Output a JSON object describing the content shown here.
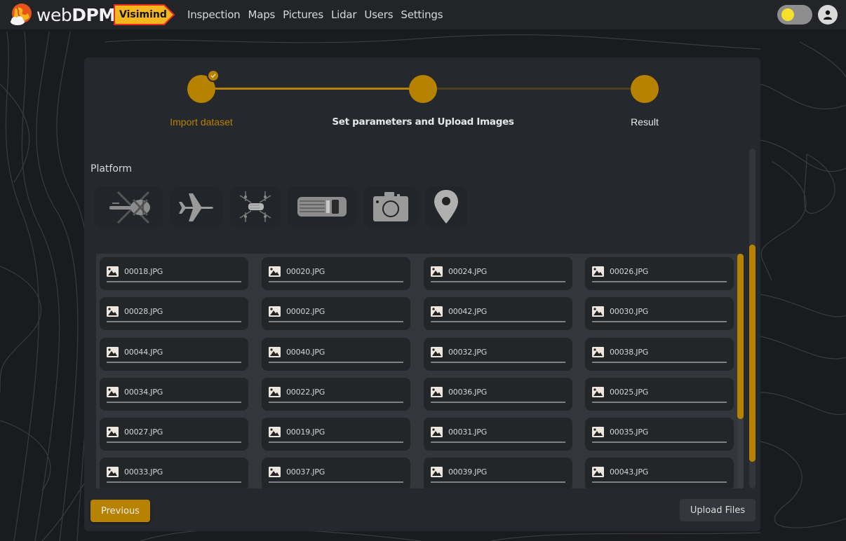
{
  "app": {
    "brand_prefix": "web",
    "brand_suffix": "DPM",
    "partner_badge": "Visimind"
  },
  "nav": {
    "items": [
      {
        "label": "Inspection"
      },
      {
        "label": "Maps"
      },
      {
        "label": "Pictures"
      },
      {
        "label": "Lidar"
      },
      {
        "label": "Users"
      },
      {
        "label": "Settings"
      }
    ]
  },
  "header": {
    "theme_toggle_icon": "sun-toggle",
    "user_icon": "user-avatar-icon"
  },
  "colors": {
    "accent": "#b68200",
    "toggle_knob": "#f5e12a",
    "card_bg": "#25282c",
    "page_bg": "#1a1b1e"
  },
  "stepper": {
    "steps": [
      {
        "label": "Import dataset",
        "state": "completed"
      },
      {
        "label": "Set parameters and Upload Images",
        "state": "active"
      },
      {
        "label": "Result",
        "state": "pending"
      }
    ]
  },
  "platform": {
    "label": "Platform",
    "options": [
      {
        "name": "helicopter",
        "icon": "helicopter-icon"
      },
      {
        "name": "airplane",
        "icon": "airplane-icon"
      },
      {
        "name": "drone",
        "icon": "drone-icon"
      },
      {
        "name": "car",
        "icon": "car-icon"
      },
      {
        "name": "camera",
        "icon": "camera-icon"
      },
      {
        "name": "location",
        "icon": "map-pin-icon"
      }
    ]
  },
  "files": {
    "items": [
      {
        "name": "00018.JPG"
      },
      {
        "name": "00020.JPG"
      },
      {
        "name": "00024.JPG"
      },
      {
        "name": "00026.JPG"
      },
      {
        "name": "00028.JPG"
      },
      {
        "name": "00002.JPG"
      },
      {
        "name": "00042.JPG"
      },
      {
        "name": "00030.JPG"
      },
      {
        "name": "00044.JPG"
      },
      {
        "name": "00040.JPG"
      },
      {
        "name": "00032.JPG"
      },
      {
        "name": "00038.JPG"
      },
      {
        "name": "00034.JPG"
      },
      {
        "name": "00022.JPG"
      },
      {
        "name": "00036.JPG"
      },
      {
        "name": "00025.JPG"
      },
      {
        "name": "00027.JPG"
      },
      {
        "name": "00019.JPG"
      },
      {
        "name": "00031.JPG"
      },
      {
        "name": "00035.JPG"
      },
      {
        "name": "00033.JPG"
      },
      {
        "name": "00037.JPG"
      },
      {
        "name": "00039.JPG"
      },
      {
        "name": "00043.JPG"
      }
    ]
  },
  "actions": {
    "previous_label": "Previous",
    "upload_label": "Upload Files"
  }
}
